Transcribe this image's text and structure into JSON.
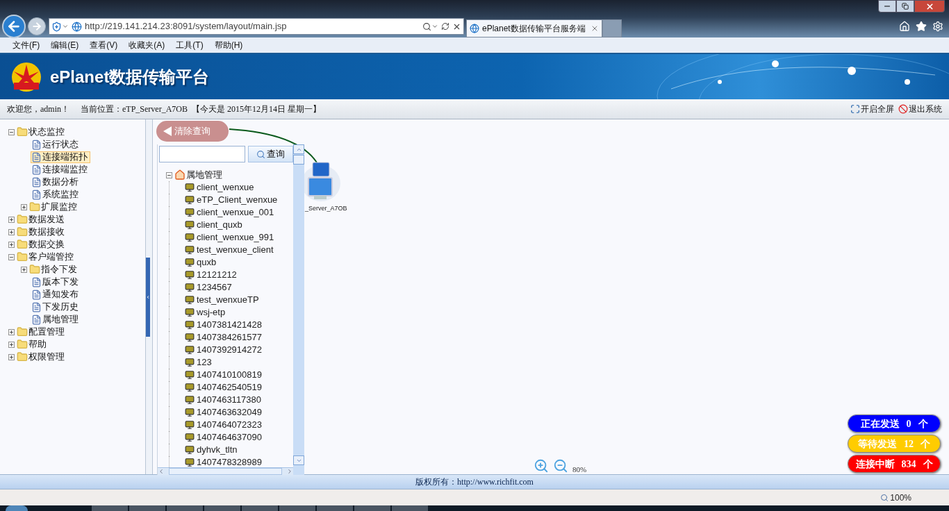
{
  "browser": {
    "address": "http://219.141.214.23:8091/system/layout/main.jsp",
    "tabs": [
      {
        "title": "ePlanet数据传输平台服务端",
        "selected": true
      }
    ],
    "menu": [
      "文件(F)",
      "编辑(E)",
      "查看(V)",
      "收藏夹(A)",
      "工具(T)",
      "帮助(H)"
    ]
  },
  "app": {
    "title": "ePlanet数据传输平台",
    "welcome": "欢迎您，admin！",
    "location": "当前位置：eTP_Server_A7OB",
    "date": "【今天是 2015年12月14日 星期一】",
    "actions": [
      {
        "kind": "fullscreen",
        "label": "开启全屏"
      },
      {
        "kind": "logout",
        "label": "退出系统"
      }
    ]
  },
  "nav": [
    {
      "kind": "folder",
      "label": "状态监控",
      "expanded": true,
      "children": [
        {
          "kind": "page",
          "label": "运行状态",
          "selected": false
        },
        {
          "kind": "page",
          "label": "连接端拓扑",
          "selected": true
        },
        {
          "kind": "page",
          "label": "连接端监控",
          "selected": false
        },
        {
          "kind": "page",
          "label": "数据分析",
          "selected": false
        },
        {
          "kind": "page",
          "label": "系统监控",
          "selected": false
        },
        {
          "kind": "folder",
          "label": "扩展监控",
          "expanded": false
        }
      ]
    },
    {
      "kind": "folder",
      "label": "数据发送",
      "expanded": false
    },
    {
      "kind": "folder",
      "label": "数据接收",
      "expanded": false
    },
    {
      "kind": "folder",
      "label": "数据交换",
      "expanded": false
    },
    {
      "kind": "folder",
      "label": "客户端管控",
      "expanded": true,
      "children": [
        {
          "kind": "folder",
          "label": "指令下发",
          "expanded": false
        },
        {
          "kind": "page",
          "label": "版本下发",
          "selected": false
        },
        {
          "kind": "page",
          "label": "通知发布",
          "selected": false
        },
        {
          "kind": "page",
          "label": "下发历史",
          "selected": false
        },
        {
          "kind": "page",
          "label": "属地管理",
          "selected": false
        }
      ]
    },
    {
      "kind": "folder",
      "label": "配置管理",
      "expanded": false
    },
    {
      "kind": "folder",
      "label": "帮助",
      "expanded": false
    },
    {
      "kind": "folder",
      "label": "权限管理",
      "expanded": false
    }
  ],
  "search_panel": {
    "clear_button": "清除查询",
    "query_button": "查询",
    "tree": {
      "label": "属地管理",
      "expanded": true,
      "children": [
        "client_wenxue",
        "eTP_Client_wenxue",
        "client_wenxue_001",
        "client_quxb",
        "client_wenxue_991",
        "test_wenxue_client",
        "quxb",
        "12121212",
        "1234567",
        "test_wenxueTP",
        "wsj-etp",
        "1407381421428",
        "1407384261577",
        "1407392914272",
        "123",
        "1407410100819",
        "1407462540519",
        "1407463117380",
        "1407463632049",
        "1407464072323",
        "1407464637090",
        "dyhvk_tltn",
        "1407478328989"
      ]
    }
  },
  "topology": {
    "server_label": "_Server_A7OB",
    "zoom": "80%"
  },
  "status_badges": [
    {
      "label": "正在发送",
      "count": "0",
      "unit": "个",
      "color": "#0000ff"
    },
    {
      "label": "等待发送",
      "count": "12",
      "unit": "个",
      "color": "#ffcc00"
    },
    {
      "label": "连接中断",
      "count": "834",
      "unit": "个",
      "color": "#ff0000"
    }
  ],
  "footer": "版权所有：http://www.richfit.com",
  "status_bar": {
    "zoom": "100%"
  }
}
